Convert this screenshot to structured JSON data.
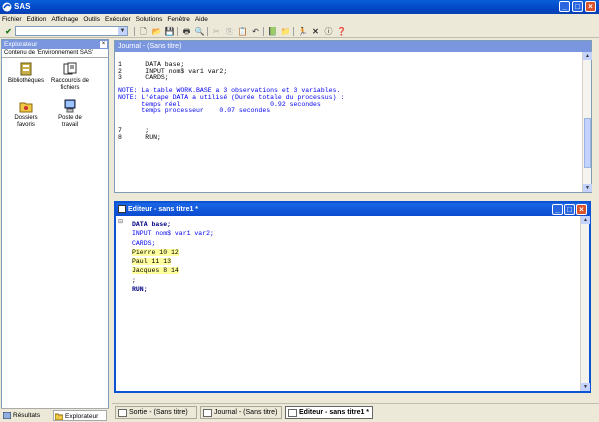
{
  "app": {
    "title": "SAS"
  },
  "menu": [
    "Fichier",
    "Edition",
    "Affichage",
    "Outils",
    "Exécuter",
    "Solutions",
    "Fenêtre",
    "Aide"
  ],
  "colors": {
    "title_bar": "#0047c7",
    "panel_header": "#7a96df",
    "log_note": "#0000ee",
    "highlight": "#ffff9e"
  },
  "explorer": {
    "title": "Explorateur",
    "subtitle": "Contenu de 'Environnement SAS'",
    "items": [
      {
        "label": "Bibliothèques",
        "icon": "libraries-icon"
      },
      {
        "label": "Raccourcis de fichiers",
        "icon": "file-shortcuts-icon"
      },
      {
        "label": "Dossiers favoris",
        "icon": "favorite-folders-icon"
      },
      {
        "label": "Poste de travail",
        "icon": "computer-icon"
      }
    ],
    "tabs": [
      "Résultats",
      "Explorateur"
    ]
  },
  "journal": {
    "title": "Journal - (Sans titre)",
    "lines": [
      {
        "text": "1      DATA base;",
        "color": "black"
      },
      {
        "text": "2      INPUT nom$ var1 var2;",
        "color": "black"
      },
      {
        "text": "3      CARDS;",
        "color": "black"
      },
      {
        "text": "",
        "color": "black"
      },
      {
        "text": "NOTE: La table WORK.BASE a 3 observations et 3 variables.",
        "color": "blue"
      },
      {
        "text": "NOTE: L'étape DATA a utilisé (Durée totale du processus) :",
        "color": "blue"
      },
      {
        "text": "      temps réel                       0.92 secondes",
        "color": "blue"
      },
      {
        "text": "      temps processeur    0.07 secondes",
        "color": "blue"
      },
      {
        "text": "",
        "color": "black"
      },
      {
        "text": "",
        "color": "black"
      },
      {
        "text": "7      ;",
        "color": "black"
      },
      {
        "text": "8      RUN;",
        "color": "black"
      }
    ]
  },
  "editor": {
    "title": "Editeur - sans titre1 *",
    "lines": [
      {
        "text": "DATA base;",
        "hl": false
      },
      {
        "text": "INPUT nom$ var1 var2;",
        "hl": false
      },
      {
        "text": "CARDS;",
        "hl": false
      },
      {
        "text": "Pierre 10 12",
        "hl": true
      },
      {
        "text": "Paul 11 13",
        "hl": true
      },
      {
        "text": "Jacques 8 14",
        "hl": true
      },
      {
        "text": ";",
        "hl": false
      },
      {
        "text": "RUN;",
        "hl": false
      }
    ]
  },
  "taskbar": [
    {
      "label": "Sortie - (Sans titre)",
      "active": false
    },
    {
      "label": "Journal - (Sans titre)",
      "active": false
    },
    {
      "label": "Editeur - sans titre1 *",
      "active": true
    }
  ]
}
